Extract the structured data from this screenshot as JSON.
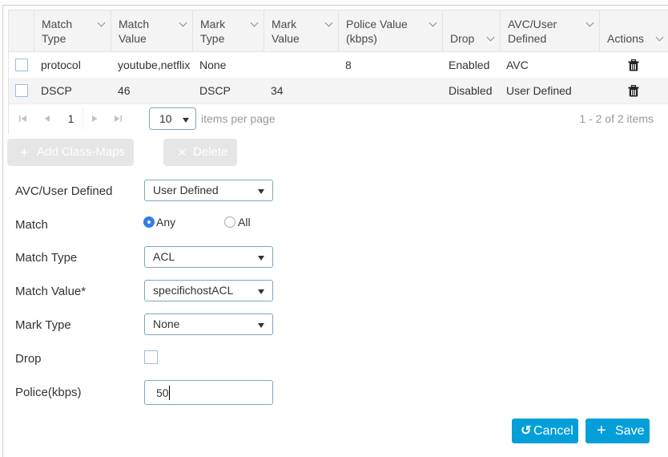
{
  "table": {
    "columns": [
      {
        "label": "Match\nType",
        "lines": 2
      },
      {
        "label": "Match\nValue",
        "lines": 2
      },
      {
        "label": "Mark\nType",
        "lines": 2
      },
      {
        "label": "Mark\nValue",
        "lines": 2
      },
      {
        "label": "Police Value\n(kbps)",
        "lines": 2
      },
      {
        "label": "Drop",
        "lines": 1
      },
      {
        "label": "AVC/User\nDefined",
        "lines": 2
      },
      {
        "label": "Actions",
        "lines": 1
      }
    ],
    "rows": [
      {
        "match_type": "protocol",
        "match_value": "youtube,netflix",
        "mark_type": "None",
        "mark_value": "",
        "police_value": "8",
        "drop": "Enabled",
        "avc_user_defined": "AVC",
        "action_icon": "trash-icon",
        "selected": false
      },
      {
        "match_type": "DSCP",
        "match_value": "46",
        "mark_type": "DSCP",
        "mark_value": "34",
        "police_value": "",
        "drop": "Disabled",
        "avc_user_defined": "User Defined",
        "action_icon": "trash-icon",
        "selected": false
      }
    ],
    "pager": {
      "current_page": "1",
      "page_size": "10",
      "items_per_page_label": "items per page",
      "range_label": "1 - 2 of 2 items",
      "first_icon": "⏮",
      "prev_icon": "◀",
      "next_icon": "▶",
      "last_icon": "⏭"
    }
  },
  "toolbar": {
    "add_label": "Add Class-Maps",
    "add_icon": "+",
    "delete_label": "Delete",
    "delete_icon": "×"
  },
  "form": {
    "avc_user_defined": {
      "label": "AVC/User Defined",
      "value": "User Defined"
    },
    "match": {
      "label": "Match",
      "options": [
        "Any",
        "All"
      ],
      "selected": "Any"
    },
    "match_type": {
      "label": "Match Type",
      "value": "ACL"
    },
    "match_value": {
      "label": "Match Value*",
      "value": "specifichostACL"
    },
    "mark_type": {
      "label": "Mark Type",
      "value": "None"
    },
    "drop": {
      "label": "Drop",
      "checked": false
    },
    "police": {
      "label": "Police(kbps)",
      "value": "50"
    }
  },
  "actions": {
    "cancel_label": "Cancel",
    "cancel_icon": "↺",
    "save_label": "Save",
    "save_icon": "+"
  },
  "colors": {
    "primary": "#049fd9",
    "radio_selected": "#2f7fe6",
    "input_border": "#7fa7b8",
    "disabled_button": "#e6e6e6"
  }
}
